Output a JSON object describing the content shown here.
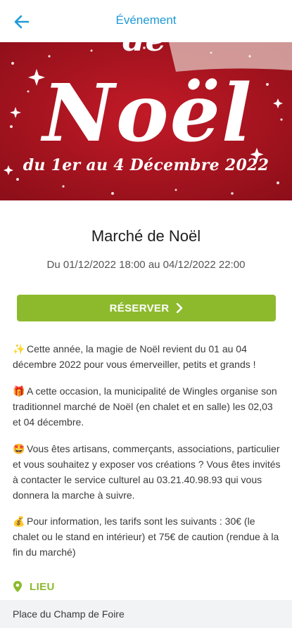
{
  "header": {
    "title": "Événement",
    "back_icon": "arrow-left-icon"
  },
  "banner": {
    "headline_top": "de",
    "headline": "Noël",
    "subline": "du 1er au 4 Décembre 2022",
    "colors": {
      "background": "#a8141f",
      "text": "#ffffff"
    }
  },
  "event": {
    "title": "Marché de Noël",
    "dates": "Du 01/12/2022 18:00 au 04/12/2022 22:00"
  },
  "reserve": {
    "label": "RÉSERVER",
    "icon": "chevron-right-icon",
    "color": "#8dba2d"
  },
  "description": {
    "paragraphs": [
      {
        "icon": "sparkles-emoji",
        "glyph": "✨",
        "text": "Cette année, la magie de Noël revient du 01 au 04 décembre 2022 pour vous émerveiller, petits et grands !"
      },
      {
        "icon": "gift-emoji",
        "glyph": "🎁",
        "text": "A cette occasion, la municipalité de Wingles organise son traditionnel marché de Noël (en chalet et en salle) les 02,03 et 04 décembre."
      },
      {
        "icon": "star-struck-emoji",
        "glyph": "🤩",
        "text": "Vous êtes artisans, commerçants, associations, particulier et vous souhaitez y exposer vos créations ? Vous êtes invités à contacter le service culturel au 03.21.40.98.93 qui vous donnera la marche à suivre."
      },
      {
        "icon": "money-bag-emoji",
        "glyph": "💰",
        "text": "Pour information, les tarifs sont les suivants : 30€ (le chalet ou le stand en intérieur) et 75€ de caution (rendue à la fin du marché)"
      }
    ]
  },
  "location": {
    "label": "LIEU",
    "icon": "map-pin-icon",
    "place": "Place du Champ de Foire"
  }
}
